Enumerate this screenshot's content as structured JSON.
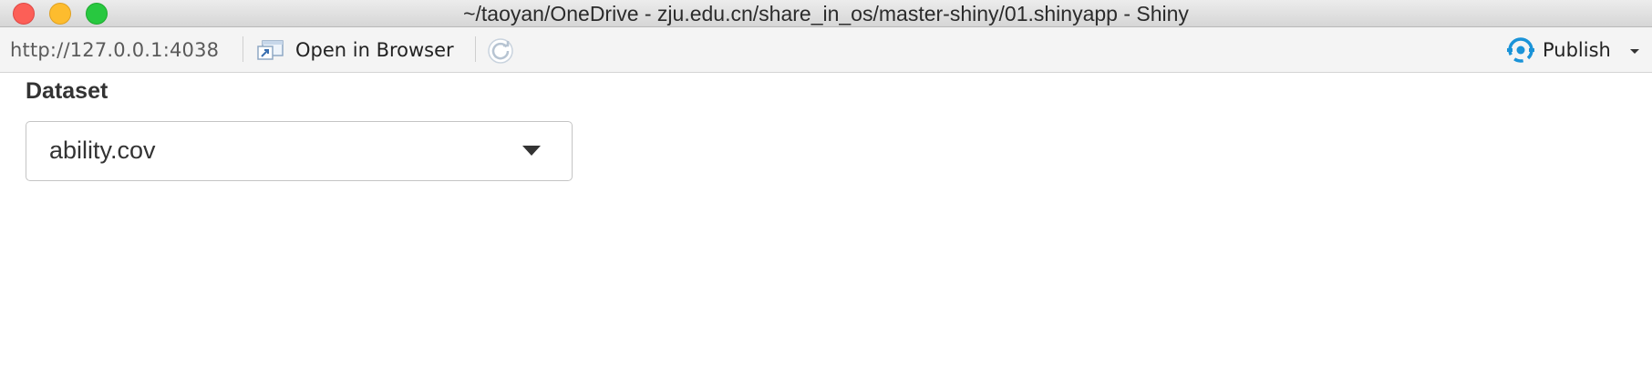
{
  "window": {
    "title": "~/taoyan/OneDrive - zju.edu.cn/share_in_os/master-shiny/01.shinyapp - Shiny"
  },
  "toolbar": {
    "url": "http://127.0.0.1:4038",
    "open_in_browser_label": "Open in Browser",
    "publish_label": "Publish",
    "icons": {
      "open_in_browser": "open-in-browser-icon",
      "refresh": "refresh-icon",
      "publish": "publish-icon",
      "publish_menu": "chevron-down-icon"
    },
    "colors": {
      "publish_accent": "#1a93d8"
    }
  },
  "app": {
    "dataset_label": "Dataset",
    "dataset_select": {
      "selected": "ability.cov"
    }
  }
}
